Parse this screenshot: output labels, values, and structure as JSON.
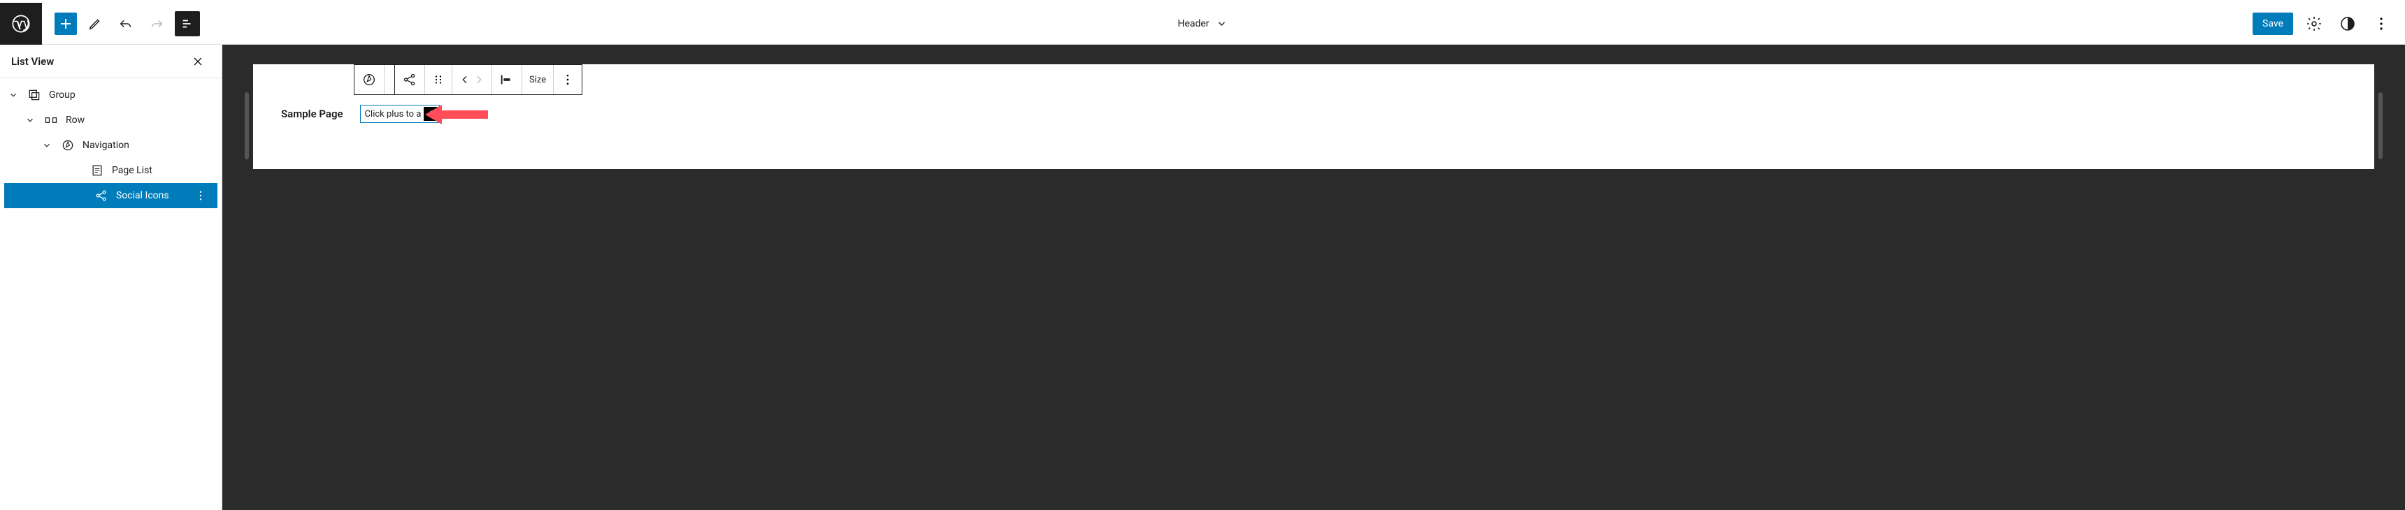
{
  "topbar": {
    "document_title": "Header",
    "save_label": "Save"
  },
  "sidebar": {
    "title": "List View",
    "items": [
      {
        "label": "Group",
        "icon": "group-icon",
        "depth": 0,
        "expanded": true,
        "selected": false
      },
      {
        "label": "Row",
        "icon": "row-icon",
        "depth": 1,
        "expanded": true,
        "selected": false
      },
      {
        "label": "Navigation",
        "icon": "navigation-icon",
        "depth": 2,
        "expanded": true,
        "selected": false
      },
      {
        "label": "Page List",
        "icon": "page-list-icon",
        "depth": 3,
        "expanded": false,
        "selected": false
      },
      {
        "label": "Social Icons",
        "icon": "share-icon",
        "depth": 3,
        "expanded": false,
        "selected": true
      }
    ]
  },
  "canvas": {
    "sample_page_label": "Sample Page",
    "social_placeholder_text": "Click plus to a",
    "block_toolbar": {
      "size_label": "Size"
    }
  }
}
